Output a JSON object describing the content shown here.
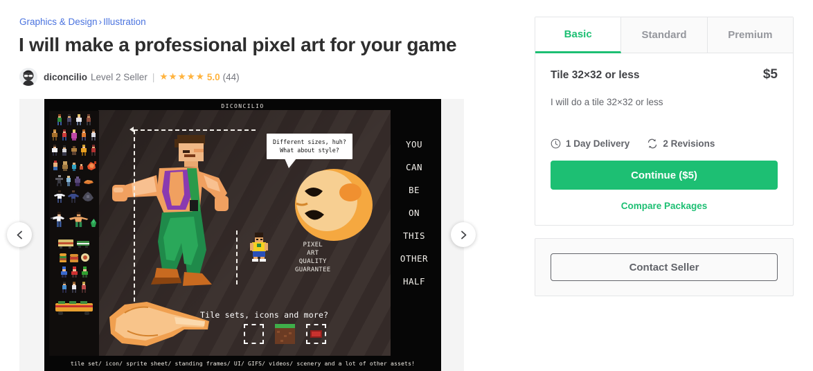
{
  "breadcrumb": {
    "category": "Graphics & Design",
    "separator": "›",
    "subcategory": "Illustration"
  },
  "gig": {
    "title": "I will make a professional pixel art for your game"
  },
  "seller": {
    "username": "diconcilio",
    "level": "Level 2 Seller",
    "rating": "5.0",
    "reviews_count": "(44)",
    "stars": [
      "★",
      "★",
      "★",
      "★",
      "★"
    ],
    "star_color": "#ffb33e"
  },
  "gallery": {
    "watermark": "DICONCILIO",
    "speech_bubble": "Different sizes, huh?\nWhat about style?",
    "vertical_caption": [
      "YOU",
      "CAN",
      "BE",
      "ON",
      "THIS",
      "OTHER",
      "HALF"
    ],
    "guarantee": "PIXEL\nART\nQUALITY\nGUARANTEE",
    "tile_prompt": "Tile sets, icons and more?",
    "bottom_caption": "tile set/ icon/ sprite sheet/ standing frames/ UI/ GIFS/ videos/ scenery and a lot of other assets!",
    "prev_label": "Previous image",
    "next_label": "Next image"
  },
  "packages": {
    "tabs": [
      {
        "label": "Basic",
        "active": true
      },
      {
        "label": "Standard",
        "active": false
      },
      {
        "label": "Premium",
        "active": false
      }
    ],
    "selected": {
      "name": "Tile 32×32 or less",
      "price": "$5",
      "description": "I will do a tile 32×32 or less",
      "delivery": "1 Day Delivery",
      "revisions": "2 Revisions",
      "continue_label": "Continue ($5)",
      "compare_label": "Compare Packages"
    }
  },
  "contact": {
    "button_label": "Contact Seller"
  },
  "colors": {
    "brand_green": "#1dbf73",
    "link_blue": "#4a73df",
    "star_gold": "#ffb33e",
    "text_dark": "#404145",
    "text_muted": "#74767e",
    "border": "#e4e5e7"
  }
}
